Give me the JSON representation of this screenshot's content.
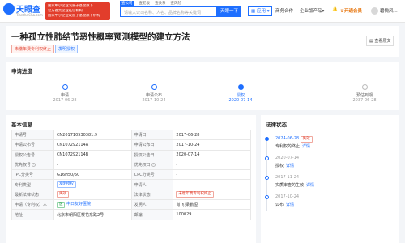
{
  "header": {
    "logo_name": "天眼查",
    "logo_url": "TianYanCha.com",
    "promo_line1": "国家中小企业发展子基金旗下",
    "promo_line2": "官方备案企业征信机构",
    "promo_line3": "国家中小企业发展子基金旗下机构",
    "search_tabs": [
      "查公司",
      "查老板",
      "查关系",
      "查风险"
    ],
    "search_placeholder": "请输入公司名称、人名、品牌名称等关键词",
    "search_button": "天眼一下",
    "apps_label": "应用",
    "nav_items": [
      "商务合作",
      "企业版产品"
    ],
    "vip_label": "开通会员",
    "user_label": "碧悦风..."
  },
  "patent": {
    "title": "一种孤立性肺结节恶性概率预测模型的建立方法",
    "tag_status": "未缴年费专利权终止",
    "tag_type": "发明授权",
    "pdf_button": "查看原文"
  },
  "progress": {
    "section_title": "申请进度",
    "steps": [
      {
        "label": "申请",
        "date": "2017-06-28",
        "state": "done"
      },
      {
        "label": "申请公布",
        "date": "2017-10-24",
        "state": "done"
      },
      {
        "label": "授权",
        "date": "2020-07-14",
        "state": "active"
      },
      {
        "label": "预估到期",
        "date": "2037-06-28",
        "state": "future"
      }
    ]
  },
  "basic_info": {
    "section_title": "基本信息",
    "rows": [
      {
        "k1": "申请号",
        "v1": "CN201710530381.9",
        "k2": "申请日",
        "v2": "2017-06-28"
      },
      {
        "k1": "申请公布号",
        "v1": "CN107292114A",
        "k2": "申请公布日",
        "v2": "2017-10-24"
      },
      {
        "k1": "授权公告号",
        "v1": "CN107292114B",
        "k2": "授权公告日",
        "v2": "2020-07-14"
      },
      {
        "k1": "优先权号",
        "v1": "-",
        "k2": "优先权日",
        "v2": "-"
      },
      {
        "k1": "IPC分类号",
        "v1": "G16H50/50",
        "k2": "CPC分类号",
        "v2": "-"
      },
      {
        "k1": "专利类型",
        "v1": "发明授权",
        "k2": "申请人",
        "v2": ""
      },
      {
        "k1": "最新法律状态",
        "v1": "失效",
        "k2": "法律状态",
        "v2": "未缴年费专利权终止"
      },
      {
        "k1": "申请（专利权）人",
        "v1": "中日友好医院",
        "k2": "发明人",
        "v2": "肖飞 梁鹏恒"
      },
      {
        "k1": "地址",
        "v1": "北京市朝阳区樱花东路2号",
        "k2": "邮编",
        "v2": "100029"
      }
    ]
  },
  "legal_status": {
    "section_title": "法律状态",
    "events": [
      {
        "date": "2024-06-28",
        "badge": "失效",
        "text": "专利权的终止",
        "link": "详情"
      },
      {
        "date": "2020-07-14",
        "text": "授权",
        "link": "详情"
      },
      {
        "date": "2017-11-24",
        "text": "实质审查的生效",
        "link": "详情"
      },
      {
        "date": "2017-10-24",
        "text": "公布",
        "link": "详情"
      }
    ]
  },
  "colors": {
    "accent": "#1e6fff",
    "danger": "#e23d2b",
    "vip": "#e6730a"
  }
}
